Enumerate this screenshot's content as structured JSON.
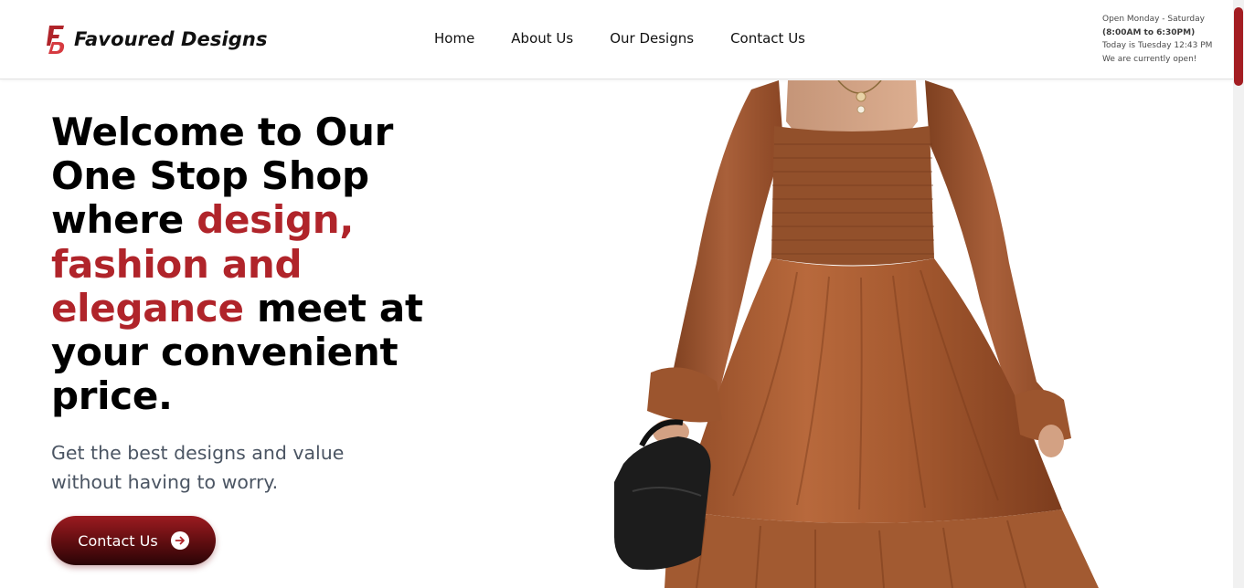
{
  "brand": {
    "name": "Favoured Designs",
    "logo_colors": [
      "#b0242a",
      "#d63a40"
    ]
  },
  "nav": {
    "items": [
      {
        "label": "Home"
      },
      {
        "label": "About Us"
      },
      {
        "label": "Our Designs"
      },
      {
        "label": "Contact Us"
      }
    ]
  },
  "hours": {
    "days": "Open Monday - Saturday",
    "time": "(8:00AM to 6:30PM)",
    "today": "Today is Tuesday 12:43 PM",
    "status": "We are currently open!"
  },
  "hero": {
    "title_part1": "Welcome to Our One Stop Shop where ",
    "title_accent": "design, fashion and elegance",
    "title_part2": " meet at your convenient price.",
    "subtitle": "Get the best designs and value without having to worry.",
    "cta_label": "Contact Us",
    "image_alt": "woman-in-brown-smocked-dress",
    "accent_color": "#b0242a"
  },
  "icons": {
    "cta": "arrow-right-circle-icon"
  }
}
